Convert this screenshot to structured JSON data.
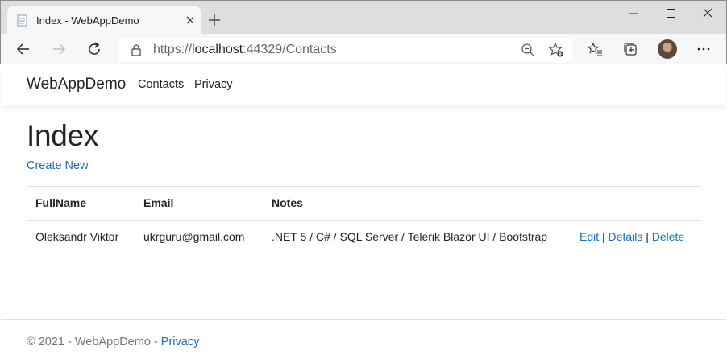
{
  "browser": {
    "tab_title": "Index - WebAppDemo",
    "url_scheme": "https://",
    "url_host": "localhost",
    "url_rest": ":44329/Contacts"
  },
  "navbar": {
    "brand": "WebAppDemo",
    "links": [
      "Contacts",
      "Privacy"
    ]
  },
  "main": {
    "title": "Index",
    "create_new": "Create New",
    "table": {
      "headers": [
        "FullName",
        "Email",
        "Notes"
      ],
      "rows": [
        {
          "fullname": "Oleksandr Viktor",
          "email": "ukrguru@gmail.com",
          "notes": ".NET 5 / C# / SQL Server / Telerik Blazor UI / Bootstrap",
          "actions": [
            "Edit",
            "Details",
            "Delete"
          ],
          "separator": "|"
        }
      ]
    }
  },
  "footer": {
    "text": "© 2021 - WebAppDemo - ",
    "privacy": "Privacy"
  },
  "colors": {
    "link": "#1b6ec2",
    "text": "#212529",
    "muted": "#6c757d"
  }
}
